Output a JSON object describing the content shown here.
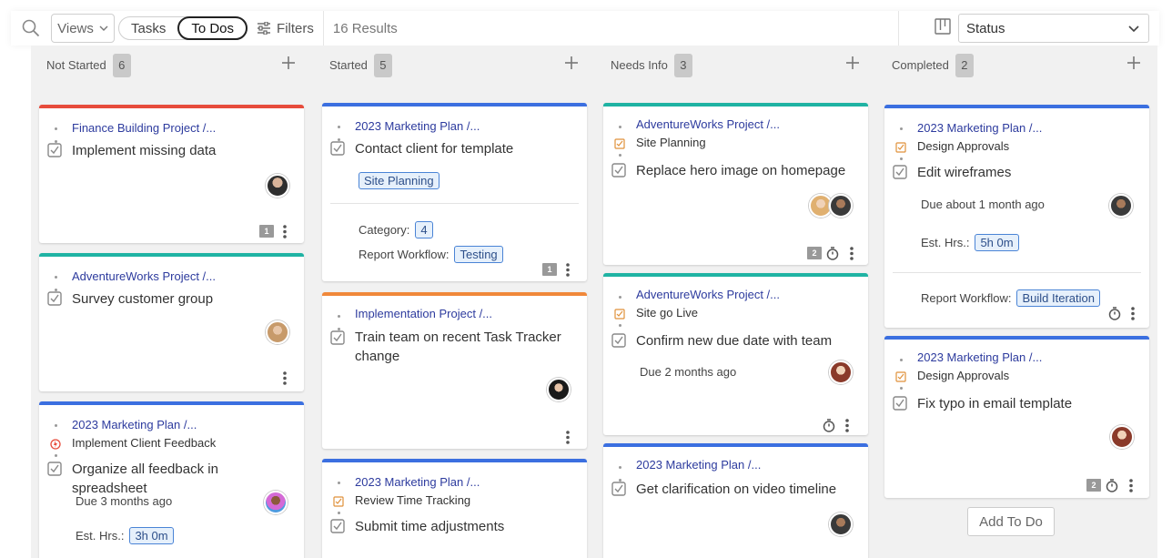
{
  "toolbar": {
    "views_label": "Views",
    "tab_tasks": "Tasks",
    "tab_todos": "To Dos",
    "filters_label": "Filters",
    "results": "16 Results",
    "group_by": "Status"
  },
  "columns": [
    {
      "label": "Not Started",
      "count": "6",
      "accent": "#e74c3c"
    },
    {
      "label": "Started",
      "count": "5"
    },
    {
      "label": "Needs Info",
      "count": "3"
    },
    {
      "label": "Completed",
      "count": "2"
    }
  ],
  "cards": {
    "c1": {
      "project": "Finance Building Project /...",
      "title": "Implement missing data",
      "comments": "1",
      "bar": "#e74c3c"
    },
    "c2": {
      "project": "AdventureWorks Project /...",
      "title": "Survey customer group",
      "bar": "#1fb3a3"
    },
    "c3": {
      "project": "2023 Marketing Plan /...",
      "subtask": "Implement Client Feedback",
      "title": "Organize all feedback in spreadsheet",
      "due": "Due 3 months ago",
      "est_label": "Est. Hrs.:",
      "est_value": "3h 0m",
      "bar": "#3b6fe0"
    },
    "s1": {
      "project": "2023 Marketing Plan /...",
      "title": "Contact client for template",
      "tag": "Site Planning",
      "category_label": "Category:",
      "category_value": "4",
      "workflow_label": "Report Workflow:",
      "workflow_value": "Testing",
      "comments": "1",
      "bar": "#3b6fe0"
    },
    "s2": {
      "project": "Implementation Project /...",
      "title": "Train team on recent Task Tracker change",
      "bar": "#f0883a"
    },
    "s3": {
      "project": "2023 Marketing Plan /...",
      "subtask": "Review Time Tracking",
      "title": "Submit time adjustments",
      "bar": "#3b6fe0"
    },
    "n1": {
      "project": "AdventureWorks Project /...",
      "subtask": "Site Planning",
      "title": "Replace hero image on homepage",
      "comments": "2",
      "bar": "#1fb3a3"
    },
    "n2": {
      "project": "AdventureWorks Project /...",
      "subtask": "Site go Live",
      "title": "Confirm new due date with team",
      "due": "Due 2 months ago",
      "bar": "#1fb3a3"
    },
    "n3": {
      "project": "2023 Marketing Plan /...",
      "title": "Get clarification on video timeline",
      "bar": "#3b6fe0"
    },
    "d1": {
      "project": "2023 Marketing Plan /...",
      "subtask": "Design Approvals",
      "title": "Edit wireframes",
      "due": "Due about 1 month ago",
      "est_label": "Est. Hrs.:",
      "est_value": "5h 0m",
      "workflow_label": "Report Workflow:",
      "workflow_value": "Build Iteration",
      "bar": "#3b6fe0"
    },
    "d2": {
      "project": "2023 Marketing Plan /...",
      "subtask": "Design Approvals",
      "title": "Fix typo in email template",
      "comments": "2",
      "bar": "#3b6fe0"
    }
  },
  "add_todo_label": "Add To Do",
  "icons": {
    "search": "search-icon",
    "chevron": "chevron-down-icon",
    "filters": "sliders-icon",
    "board": "board-view-icon",
    "plus": "plus-icon",
    "checkbox": "todo-checkbox-icon",
    "kebab": "more-vertical-icon",
    "comment": "comment-count-icon",
    "timer": "stopwatch-icon"
  }
}
